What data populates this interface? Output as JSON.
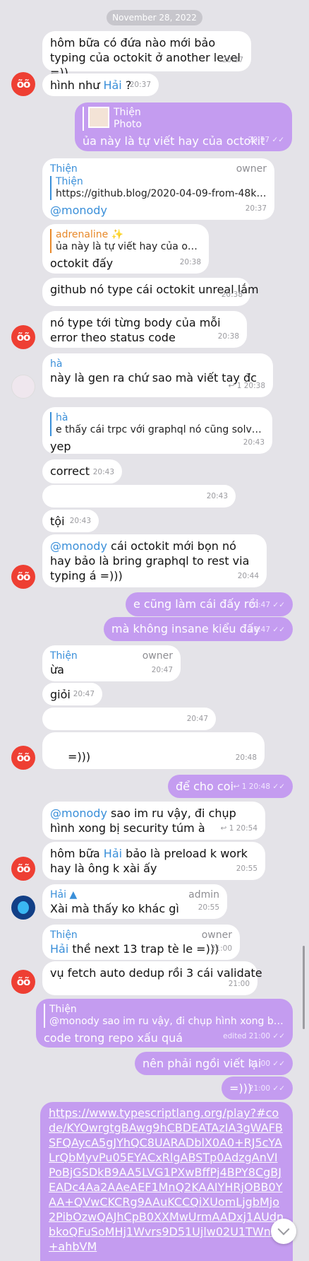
{
  "date_pill": "November 28, 2022",
  "owner_badge": "owner",
  "admin_badge": "admin",
  "avatar_initials": "õõ",
  "m01": {
    "text": "hôm bữa có đứa nào mới bảo typing của octokit ở another level =))",
    "time": "20:37"
  },
  "m02": {
    "prefix": "hình như ",
    "mention": "Hải",
    "suffix": " ?",
    "time": "20:37"
  },
  "m03": {
    "quote_name": "Thiện",
    "quote_text": "Photo",
    "text": "ủa này là tự viết hay của octokit",
    "time": "20:37"
  },
  "m04": {
    "sender": "Thiện",
    "quote_name": "Thiện",
    "quote_text": "https://github.blog/2020-04-09-from-48k-li…",
    "text": "@monody",
    "time": "20:37"
  },
  "m05": {
    "quote_name": "adrenaline ✨",
    "quote_text": "ủa này là tự viết hay của octokit",
    "text": "octokit đấy",
    "time": "20:38"
  },
  "m06": {
    "text": "github nó type cái octokit unreal lắm",
    "time": "20:38"
  },
  "m07": {
    "text": "nó type tới từng body của mỗi error theo status code",
    "time": "20:38"
  },
  "m08": {
    "sender": "hà",
    "text": "này là gen ra chứ sao mà viết tay đc",
    "reply_count": "1",
    "time": "20:38"
  },
  "m09": {
    "quote_name": "hà",
    "quote_text": "e thấy cái trpc với graphql nó cũng solve cái…",
    "text": "yep",
    "time": "20:43"
  },
  "m10": {
    "text": "correct",
    "time": "20:43"
  },
  "m11": {
    "time": "20:43"
  },
  "m12": {
    "text": "tội",
    "time": "20:43"
  },
  "m13": {
    "mention": "@monody",
    "text": " cái octokit mới bọn nó hay bảo là bring graphql to rest via typing á =)))",
    "time": "20:44"
  },
  "m14": {
    "text": "e cũng làm cái đấy rồi",
    "time": "20:47"
  },
  "m15": {
    "text": "mà không insane kiểu đấy",
    "time": "20:47"
  },
  "m16": {
    "sender": "Thiện",
    "text": "ừa",
    "time": "20:47"
  },
  "m17": {
    "text": "giỏi",
    "time": "20:47"
  },
  "m18": {
    "time": "20:47"
  },
  "m19": {
    "text": "=)))",
    "time": "20:48"
  },
  "m20": {
    "text": "để cho coi",
    "reply_count": "1",
    "time": "20:48"
  },
  "m21": {
    "mention": "@monody",
    "text": " sao im ru vậy, đi chụp hình xong bị security túm à",
    "reply_count": "1",
    "time": "20:54"
  },
  "m22": {
    "prefix": "hôm bữa ",
    "mention": "Hải",
    "suffix": " bảo là preload k work hay là ông k xài ấy",
    "time": "20:55"
  },
  "m23": {
    "sender": "Hải ▲",
    "text": "Xài mà thấy ko khác gì",
    "time": "20:55"
  },
  "m24": {
    "sender": "Thiện",
    "mention": "Hải",
    "suffix": " thề next 13 trap tè le =)))",
    "time": "21:00"
  },
  "m25": {
    "text": "vụ fetch auto dedup rồi 3 cái validate",
    "time": "21:00"
  },
  "m26": {
    "quote_name": "Thiện",
    "quote_text": "@monody sao im ru vậy, đi chụp hình xong bị se…",
    "text": "code trong repo xấu quá",
    "time": "edited 21:00"
  },
  "m27": {
    "text": "nên phải ngồi viết lại",
    "time": "21:00"
  },
  "m28": {
    "text": "=)))",
    "time": "21:00"
  },
  "m29": {
    "link": "https://www.typescriptlang.org/play?#code/KYOwrgtgBAwg9hCBDEATAzIA3gWAFBSFQAycA5gJYhQC8UARADblX0A0+RJ5cYALrQbMyvPu05EYACxRlgABSTp0AdzgAnVIPoBjGSDkB9AA5LVG1PXwBffPj4BPY8CgBJEADc4Aa2AAeAEF1MnQ2KAAIYHRjOBB0YAA+QVwCKCRg9AAuKCCQiXUomLjgbMjo2PibOzwQAJhCpB0XXMwUrmAADxj1AUdnbkoQFuSoMHj1Wvrs9D51Ujlw02U1TWnZ+ahbVM"
  },
  "colors": {
    "outgoing": "#c49cf0",
    "incoming": "#ffffff",
    "mention": "#3a8fd9",
    "background": "#e4e3e8",
    "avatar_red": "#ee3f33"
  },
  "icons": {
    "read_receipt": "double-check-icon",
    "reply": "reply-arrow-icon",
    "scroll_down": "chevron-down-icon"
  }
}
